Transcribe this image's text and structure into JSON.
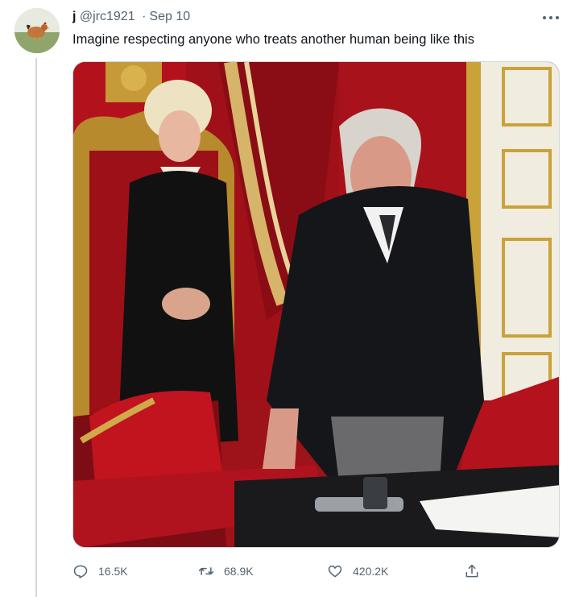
{
  "tweet": {
    "author_name": "j",
    "handle": "@jrc1921",
    "separator": "·",
    "date": "Sep 10",
    "text": "Imagine respecting anyone who treats another human being like this"
  },
  "actions": {
    "reply_count": "16.5K",
    "retweet_count": "68.9K",
    "like_count": "420.2K"
  },
  "icons": {
    "avatar": "rooster-avatar",
    "more": "more-icon",
    "reply": "reply-icon",
    "retweet": "retweet-icon",
    "like": "heart-icon",
    "share": "share-icon"
  },
  "colors": {
    "secondary_text": "#536471",
    "thread_line": "#cfd9de",
    "red_velvet": "#b3121c",
    "gold": "#c9a23a"
  }
}
